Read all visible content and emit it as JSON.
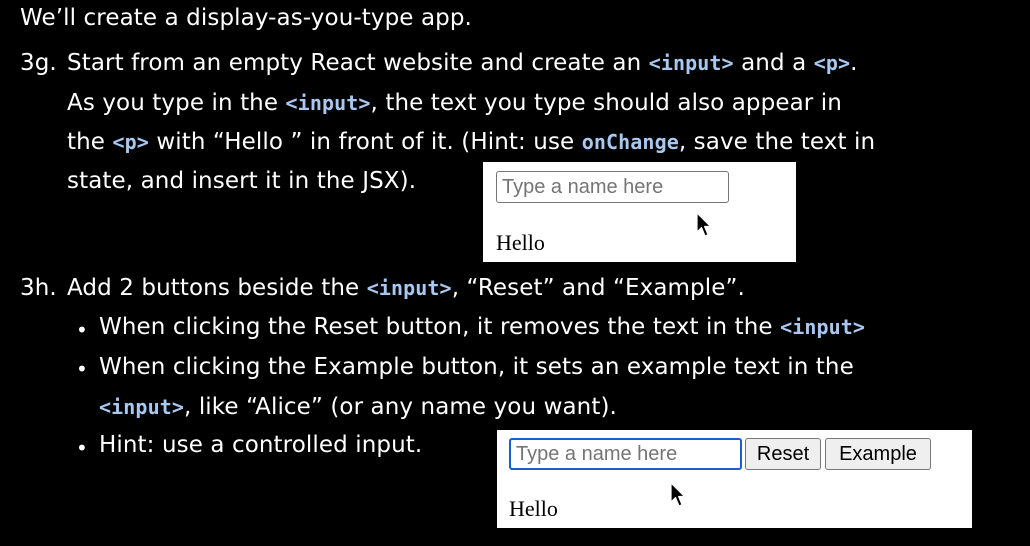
{
  "intro": "We’ll create a display-as-you-type app.",
  "step3g": {
    "number": "3g.",
    "l1_a": "Start from an empty React website and create an ",
    "l1_code1": "<input>",
    "l1_b": " and a ",
    "l1_code2": "<p>",
    "l1_c": ".",
    "l2_a": "As you type in the ",
    "l2_code": "<input>",
    "l2_b": ", the text you type should also appear in",
    "l3_a": "the ",
    "l3_code1": "<p>",
    "l3_b": " with “Hello ” in front of it. (Hint: use ",
    "l3_code2": "onChange",
    "l3_c": ", save the text in",
    "l4": "state, and insert it in the JSX)."
  },
  "demo1": {
    "input_placeholder": "Type a name here",
    "hello_text": "Hello"
  },
  "step3h": {
    "number": "3h.",
    "l1_a": "Add 2 buttons beside the ",
    "l1_code": "<input>",
    "l1_b": ", “Reset” and “Example”.",
    "b1_a": "When clicking the Reset button, it removes the text in the ",
    "b1_code": "<input>",
    "b2_a": "When clicking the Example button, it sets an example text in the",
    "b2_code": "<input>",
    "b2_b": ", like “Alice” (or any name you want).",
    "b3": "Hint: use a controlled input.",
    "bullet": "•"
  },
  "demo2": {
    "input_placeholder": "Type a name here",
    "reset_label": "Reset",
    "example_label": "Example",
    "hello_text": "Hello"
  }
}
